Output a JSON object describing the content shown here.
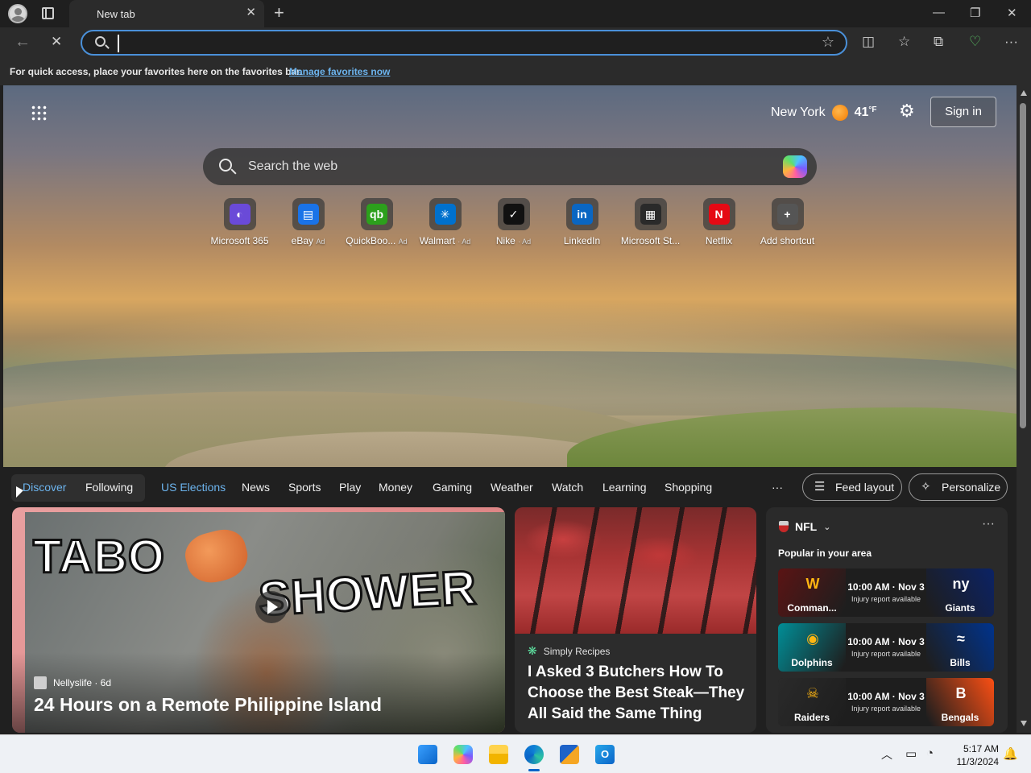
{
  "browser": {
    "tab_title": "New tab",
    "tab_close": "✕",
    "new_tab": "+",
    "win_minimize": "—",
    "win_restore": "❐",
    "win_close": "✕",
    "back": "←",
    "stop": "✕",
    "address_value": "",
    "favorites_hint": "For quick access, place your favorites here on the favorites bar.",
    "favorites_link": "Manage favorites now"
  },
  "header": {
    "city": "New York",
    "temperature": "41",
    "temp_unit": "°F",
    "sign_in": "Sign in"
  },
  "search": {
    "placeholder": "Search the web"
  },
  "shortcuts": [
    {
      "label": "Microsoft 365",
      "ad": "",
      "glyph": "◐",
      "color": "#6a4ad8"
    },
    {
      "label": "eBay",
      "ad": "Ad",
      "glyph": "▤",
      "color": "#1a73e8"
    },
    {
      "label": "QuickBoo...",
      "ad": "Ad",
      "glyph": "qb",
      "color": "#2ca01c"
    },
    {
      "label": "Walmart",
      "ad": "· Ad",
      "glyph": "✳",
      "color": "#0071ce"
    },
    {
      "label": "Nike",
      "ad": "· Ad",
      "glyph": "✓",
      "color": "#111111"
    },
    {
      "label": "LinkedIn",
      "ad": "",
      "glyph": "in",
      "color": "#0a66c2"
    },
    {
      "label": "Microsoft St...",
      "ad": "",
      "glyph": "▦",
      "color": "#2a2a2a"
    },
    {
      "label": "Netflix",
      "ad": "",
      "glyph": "N",
      "color": "#e50914"
    },
    {
      "label": "Add shortcut",
      "ad": "",
      "glyph": "+",
      "color": "#555555"
    }
  ],
  "feed_nav": {
    "discover": "Discover",
    "following": "Following",
    "items": [
      "US Elections",
      "News",
      "Sports",
      "Play",
      "Money",
      "Gaming",
      "Weather",
      "Watch",
      "Learning",
      "Shopping"
    ],
    "more": "···",
    "feed_layout": "Feed layout",
    "personalize": "Personalize"
  },
  "cards": {
    "video": {
      "overlay_1": "TABO",
      "overlay_2": "SHOWER",
      "source": "Nellyslife · 6d",
      "title": "24 Hours on a Remote Philippine Island"
    },
    "article": {
      "source": "Simply Recipes",
      "title": "I Asked 3 Butchers How To Choose the Best Steak—They All Said the Same Thing"
    },
    "nfl": {
      "league": "NFL",
      "more": "···",
      "subtitle": "Popular in your area",
      "games": [
        {
          "home": "Comman...",
          "home_logo": "W",
          "home_color": "#5a1414",
          "away": "Giants",
          "away_logo": "ny",
          "away_color": "#0b2265",
          "time": "10:00 AM · Nov 3",
          "note": "Injury report available"
        },
        {
          "home": "Dolphins",
          "home_logo": "◉",
          "home_color": "#008e97",
          "away": "Bills",
          "away_logo": "≈",
          "away_color": "#00338d",
          "time": "10:00 AM · Nov 3",
          "note": "Injury report available"
        },
        {
          "home": "Raiders",
          "home_logo": "☠",
          "home_color": "#2a2a2a",
          "away": "Bengals",
          "away_logo": "B",
          "away_color": "#fb4f14",
          "time": "10:00 AM · Nov 3",
          "note": "Injury report available"
        }
      ]
    }
  },
  "taskbar": {
    "time": "5:17 AM",
    "date": "11/3/2024"
  }
}
